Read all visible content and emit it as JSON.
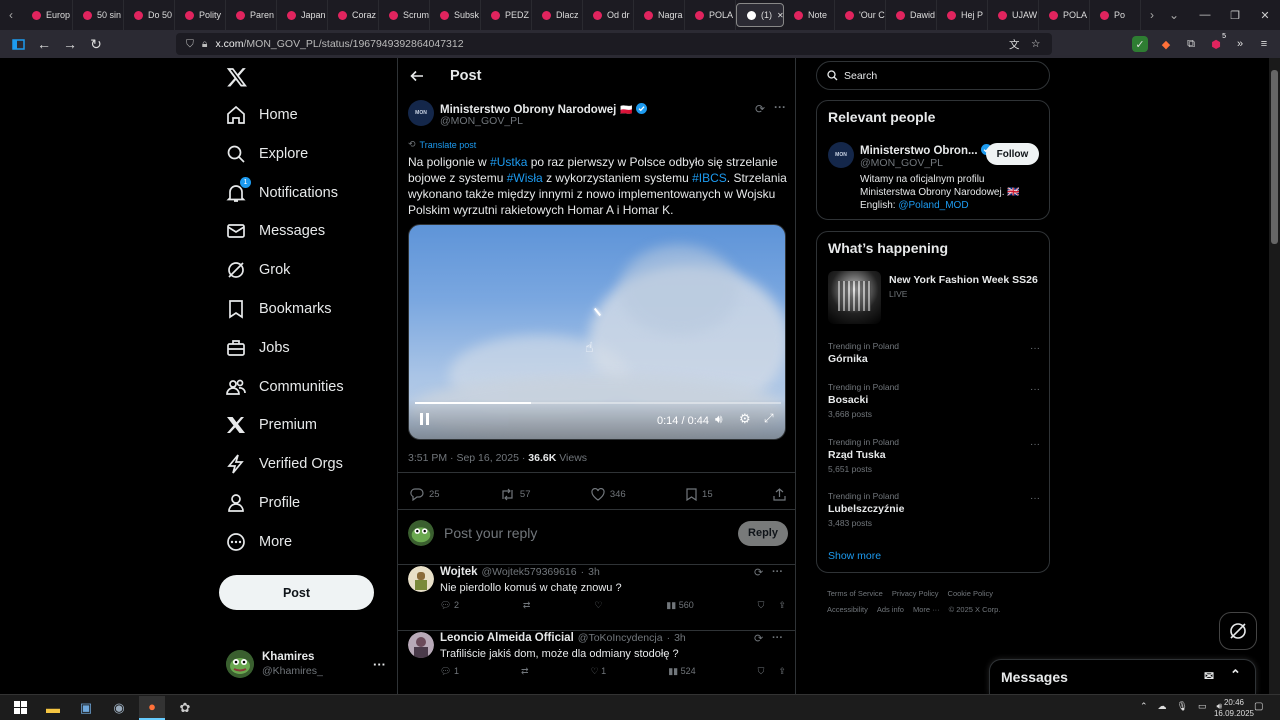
{
  "browser": {
    "tabs": [
      "Europ",
      "50 sin",
      "Do 50",
      "Polity",
      "Paren",
      "Japan",
      "Coraz",
      "Scrum",
      "Subsk",
      "PEDZ",
      "Dlacz",
      "Od dr",
      "Nagra",
      "POLA",
      "(1)",
      "Note",
      "'Our C",
      "Dawid",
      "Hej P",
      "UJAW",
      "POLA",
      "Po"
    ],
    "active_tab_index": 14,
    "url_host": "x.com",
    "url_path": "/MON_GOV_PL/status/1967949392864047312",
    "ext_badge": "5"
  },
  "nav": {
    "items": [
      {
        "label": "Home",
        "icon": "home-icon"
      },
      {
        "label": "Explore",
        "icon": "search-icon"
      },
      {
        "label": "Notifications",
        "icon": "bell-icon"
      },
      {
        "label": "Messages",
        "icon": "envelope-icon"
      },
      {
        "label": "Grok",
        "icon": "grok-icon"
      },
      {
        "label": "Bookmarks",
        "icon": "bookmark-icon"
      },
      {
        "label": "Jobs",
        "icon": "briefcase-icon"
      },
      {
        "label": "Communities",
        "icon": "people-icon"
      },
      {
        "label": "Premium",
        "icon": "x-icon"
      },
      {
        "label": "Verified Orgs",
        "icon": "lightning-icon"
      },
      {
        "label": "Profile",
        "icon": "person-icon"
      },
      {
        "label": "More",
        "icon": "more-circle-icon"
      }
    ],
    "notifications_badge": "1",
    "post_button": "Post",
    "user": {
      "name": "Khamires",
      "handle": "@Khamires_"
    }
  },
  "post": {
    "header_title": "Post",
    "author_name": "Ministerstwo Obrony Narodowej",
    "author_flag": "🇵🇱",
    "author_handle": "@MON_GOV_PL",
    "avatar_text": "MON",
    "translate_label": "Translate post",
    "text_parts": [
      {
        "t": "Na poligonie w ",
        "tag": false
      },
      {
        "t": "#Ustka",
        "tag": true
      },
      {
        "t": " po raz pierwszy w Polsce odbyło się strzelanie bojowe z systemu ",
        "tag": false
      },
      {
        "t": "#Wisła",
        "tag": true
      },
      {
        "t": " z wykorzystaniem systemu ",
        "tag": false
      },
      {
        "t": "#IBCS",
        "tag": true
      },
      {
        "t": ". Strzelania wykonano także między innymi z nowo implementowanych w Wojsku Polskim wyrzutni rakietowych Homar A i Homar K.",
        "tag": false
      }
    ],
    "video": {
      "current": "0:14",
      "duration": "0:44",
      "time_display": "0:14 / 0:44",
      "progress": 0.318
    },
    "time": "3:51 PM",
    "date": "Sep 16, 2025",
    "views_count": "36.6K",
    "views_label": "Views",
    "replies": "25",
    "reposts": "57",
    "likes": "346",
    "bookmarks": "15",
    "reply_placeholder": "Post your reply",
    "reply_button": "Reply"
  },
  "replies": [
    {
      "name": "Wojtek",
      "handle": "@Wojtek579369616",
      "time": "3h",
      "text": "Nie pierdollo komuś  w chatę znowu ?",
      "replies": "2",
      "reposts": "",
      "likes": "",
      "views": "560"
    },
    {
      "name": "Leoncio Almeida Official",
      "handle": "@ToKoIncydencja",
      "time": "3h",
      "text": "Trafiliście jakiś dom, może dla odmiany stodołę ?",
      "replies": "1",
      "reposts": "",
      "likes": "1",
      "views": "524"
    }
  ],
  "sidebar": {
    "search_placeholder": "Search",
    "relevant_title": "Relevant people",
    "relevant": {
      "name": "Ministerstwo Obron...",
      "handle": "@MON_GOV_PL",
      "follow": "Follow",
      "bio": "Witamy na oficjalnym profilu Ministerstwa Obrony Narodowej. 🇬🇧 English: ",
      "bio_link": "@Poland_MOD"
    },
    "happening_title": "What’s happening",
    "featured": {
      "title": "New York Fashion Week SS26",
      "status": "LIVE"
    },
    "trends": [
      {
        "context": "Trending in Poland",
        "name": "Górnika",
        "posts": ""
      },
      {
        "context": "Trending in Poland",
        "name": "Bosacki",
        "posts": "3,668 posts"
      },
      {
        "context": "Trending in Poland",
        "name": "Rząd Tuska",
        "posts": "5,651 posts"
      },
      {
        "context": "Trending in Poland",
        "name": "Lubelszczyźnie",
        "posts": "3,483 posts"
      }
    ],
    "show_more": "Show more",
    "footer": [
      "Terms of Service",
      "Privacy Policy",
      "Cookie Policy",
      "Accessibility",
      "Ads info",
      "More ···",
      "© 2025 X Corp."
    ]
  },
  "messages_bar": {
    "title": "Messages"
  },
  "taskbar": {
    "time": "20:46",
    "date": "16.09.2025"
  },
  "colors": {
    "accent": "#1d9bf0",
    "background": "#000000",
    "border": "#2f3336",
    "muted": "#71767b"
  }
}
